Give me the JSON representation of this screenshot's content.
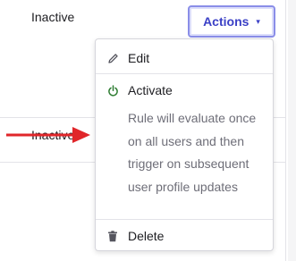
{
  "rows": [
    {
      "status": "Inactive"
    },
    {
      "status": "Inactive"
    }
  ],
  "actions_button": {
    "label": "Actions",
    "caret": "▾"
  },
  "menu": {
    "edit_label": "Edit",
    "activate_label": "Activate",
    "activate_description": "Rule will evaluate once on all users and then trigger on subsequent user profile updates",
    "delete_label": "Delete"
  },
  "colors": {
    "accent": "#3b40c6",
    "activate_icon": "#2e7d32",
    "annotation_arrow": "#e0262a"
  },
  "icons": {
    "edit": "pencil-icon",
    "activate": "power-icon",
    "delete": "trash-icon",
    "annotation": "red-arrow-icon"
  }
}
